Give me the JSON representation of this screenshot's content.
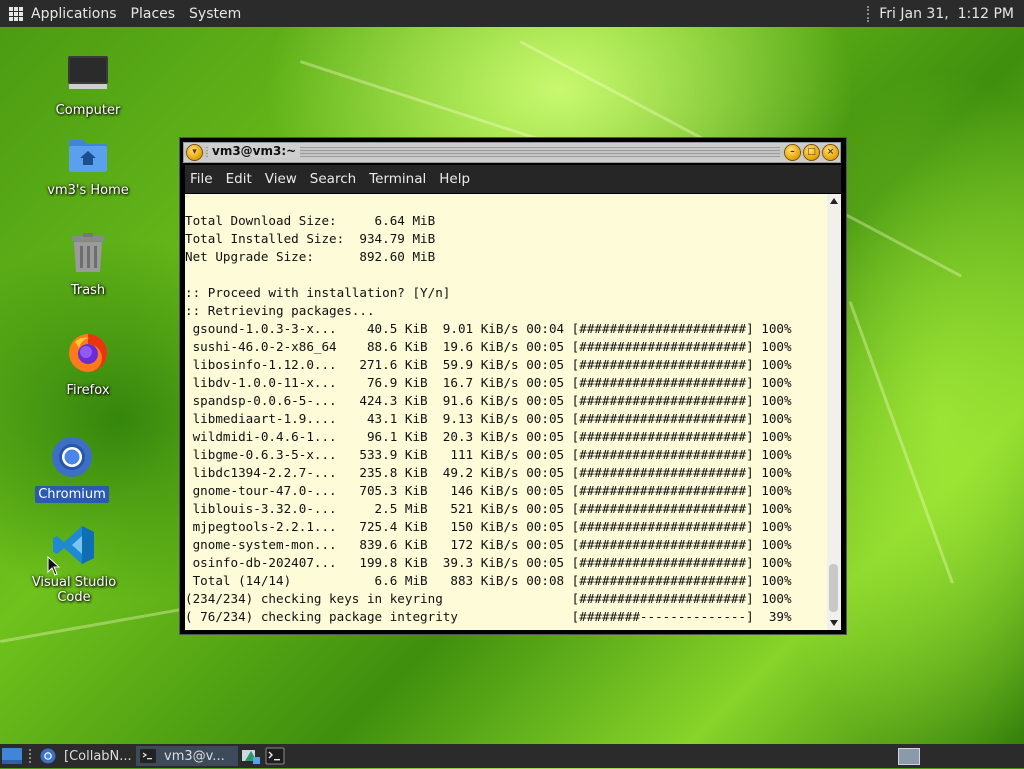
{
  "top_panel": {
    "menus": [
      "Applications",
      "Places",
      "System"
    ],
    "clock": "Fri Jan 31,  1:12 PM"
  },
  "desktop": {
    "icons": [
      {
        "label": "Computer",
        "icon": "computer-icon"
      },
      {
        "label": "vm3's Home",
        "icon": "home-folder-icon"
      },
      {
        "label": "Trash",
        "icon": "trash-icon"
      },
      {
        "label": "Firefox",
        "icon": "firefox-icon"
      },
      {
        "label": "Chromium",
        "icon": "chromium-icon"
      },
      {
        "label": "Visual Studio Code",
        "icon": "vscode-icon"
      }
    ]
  },
  "terminal": {
    "title": "vm3@vm3:~",
    "menu": [
      "File",
      "Edit",
      "View",
      "Search",
      "Terminal",
      "Help"
    ],
    "lines": [
      "Total Download Size:     6.64 MiB",
      "Total Installed Size:  934.79 MiB",
      "Net Upgrade Size:      892.60 MiB",
      "",
      ":: Proceed with installation? [Y/n]",
      ":: Retrieving packages...",
      " gsound-1.0.3-3-x...    40.5 KiB  9.01 KiB/s 00:04 [######################] 100%",
      " sushi-46.0-2-x86_64    88.6 KiB  19.6 KiB/s 00:05 [######################] 100%",
      " libosinfo-1.12.0...   271.6 KiB  59.9 KiB/s 00:05 [######################] 100%",
      " libdv-1.0.0-11-x...    76.9 KiB  16.7 KiB/s 00:05 [######################] 100%",
      " spandsp-0.0.6-5-...   424.3 KiB  91.6 KiB/s 00:05 [######################] 100%",
      " libmediaart-1.9....    43.1 KiB  9.13 KiB/s 00:05 [######################] 100%",
      " wildmidi-0.4.6-1...    96.1 KiB  20.3 KiB/s 00:05 [######################] 100%",
      " libgme-0.6.3-5-x...   533.9 KiB   111 KiB/s 00:05 [######################] 100%",
      " libdc1394-2.2.7-...   235.8 KiB  49.2 KiB/s 00:05 [######################] 100%",
      " gnome-tour-47.0-...   705.3 KiB   146 KiB/s 00:05 [######################] 100%",
      " liblouis-3.32.0-...     2.5 MiB   521 KiB/s 00:05 [######################] 100%",
      " mjpegtools-2.2.1...   725.4 KiB   150 KiB/s 00:05 [######################] 100%",
      " gnome-system-mon...   839.6 KiB   172 KiB/s 00:05 [######################] 100%",
      " osinfo-db-202407...   199.8 KiB  39.3 KiB/s 00:05 [######################] 100%",
      " Total (14/14)           6.6 MiB   883 KiB/s 00:08 [######################] 100%",
      "(234/234) checking keys in keyring                 [######################] 100%",
      "( 76/234) checking package integrity               [########--------------]  39%"
    ]
  },
  "taskbar": {
    "items": [
      {
        "label": "[CollabN...",
        "icon": "chromium-icon"
      },
      {
        "label": "vm3@v...",
        "icon": "terminal-icon"
      }
    ],
    "tray_icons": [
      "network-icon",
      "terminal-icon"
    ]
  },
  "colors": {
    "panel_bg": "#2b2b2b",
    "terminal_bg": "#fdfbd8",
    "selection_blue": "#2a5bb0"
  }
}
